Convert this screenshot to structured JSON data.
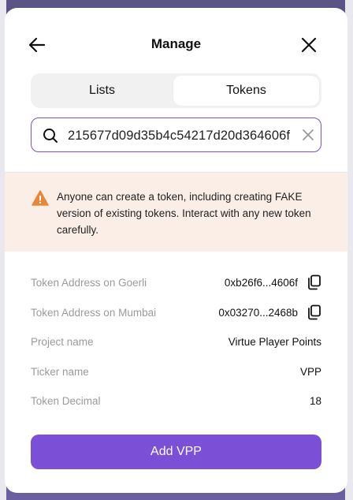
{
  "header": {
    "title": "Manage"
  },
  "tabs": [
    {
      "label": "Lists"
    },
    {
      "label": "Tokens"
    }
  ],
  "active_tab": "Tokens",
  "search": {
    "value": "215677d09d35b4c54217d20d364606f"
  },
  "warning": {
    "text": "Anyone can create a token, including creating FAKE version of existing tokens. Interact with any new token carefully."
  },
  "details": [
    {
      "label": "Token Address on Goerli",
      "value": "0xb26f6...4606f",
      "copyable": true
    },
    {
      "label": "Token Address on Mumbai",
      "value": "0x03270...2468b",
      "copyable": true
    },
    {
      "label": "Project name",
      "value": "Virtue Player Points",
      "copyable": false
    },
    {
      "label": "Ticker name",
      "value": "VPP",
      "copyable": false
    },
    {
      "label": "Token Decimal",
      "value": "18",
      "copyable": false
    }
  ],
  "action": {
    "label": "Add VPP"
  },
  "colors": {
    "accent": "#7b4fd6",
    "warning_bg": "#fbeee6",
    "warning_icon": "#e8873a"
  }
}
